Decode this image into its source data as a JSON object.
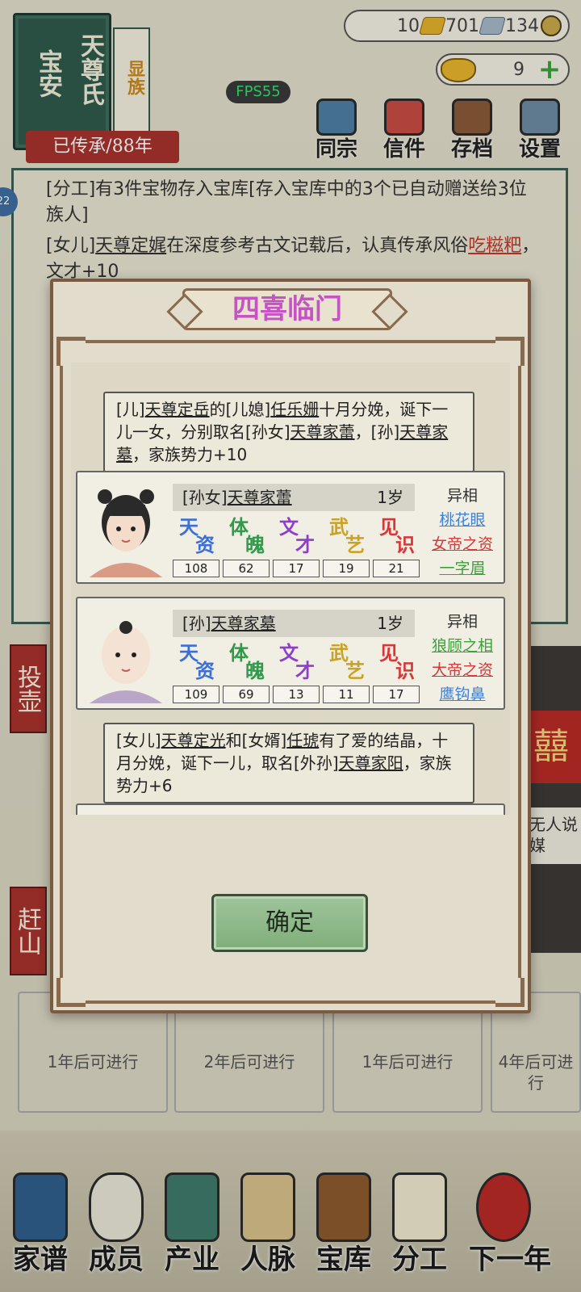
{
  "banner": {
    "title_col1": "天尊氏",
    "title_col2": "宝安",
    "tag": "显族",
    "generation": "已传承/88年"
  },
  "fps": "FPS55",
  "resources": {
    "gold_bar": "10",
    "silver_bar": "701",
    "coin": "134",
    "ingot": "9"
  },
  "top_menu": [
    "同宗",
    "信件",
    "存档",
    "设置"
  ],
  "log": {
    "badge": "22",
    "line1": "[分工]有3件宝物存入宝库[存入宝库中的3个已自动赠送给3位族人]",
    "line2_prefix": "[女儿]",
    "line2_name": "天尊定娓",
    "line2_mid": "在深度参考古文记载后，认真传承风俗",
    "line2_custom": "吃糍粑",
    "line2_suffix": "，文才+10"
  },
  "side_tabs": [
    "投壶",
    "赶山"
  ],
  "bg_cards": [
    "1年后可进行",
    "2年后可进行",
    "1年后可进行",
    "4年后可进行"
  ],
  "right_card": {
    "xi": "囍",
    "msg": "无人说媒"
  },
  "bottom_nav": [
    "家谱",
    "成员",
    "产业",
    "人脉",
    "宝库",
    "分工",
    "下一年"
  ],
  "dialog": {
    "title": "四喜临门",
    "event1": {
      "p1": "[儿]",
      "n1": "天尊定岳",
      "p2": "的[儿媳]",
      "n2": "任乐姗",
      "p3": "十月分娩，诞下一儿一女，分别取名[孙女]",
      "n3": "天尊家蕾",
      "p4": "，[孙]",
      "n4": "天尊家墓",
      "p5": "，家族势力+10"
    },
    "chars": [
      {
        "relation": "[孙女]",
        "name": "天尊家蕾",
        "age": "1岁",
        "stats": [
          {
            "l1": "天",
            "l2": "资",
            "value": "108",
            "color": "#3b6fd6"
          },
          {
            "l1": "体",
            "l2": "魄",
            "value": "62",
            "color": "#2e9b4a"
          },
          {
            "l1": "文",
            "l2": "才",
            "value": "17",
            "color": "#8e3fc9"
          },
          {
            "l1": "武",
            "l2": "艺",
            "value": "19",
            "color": "#c9a224"
          },
          {
            "l1": "见",
            "l2": "识",
            "value": "21",
            "color": "#d23a3a"
          }
        ],
        "traits_head": "异相",
        "traits": [
          {
            "name": "桃花眼",
            "color": "#3e82d6"
          },
          {
            "name": "女帝之资",
            "color": "#d23a3a"
          },
          {
            "name": "一字眉",
            "color": "#3aa33a"
          }
        ]
      },
      {
        "relation": "[孙]",
        "name": "天尊家墓",
        "age": "1岁",
        "stats": [
          {
            "l1": "天",
            "l2": "资",
            "value": "109",
            "color": "#3b6fd6"
          },
          {
            "l1": "体",
            "l2": "魄",
            "value": "69",
            "color": "#2e9b4a"
          },
          {
            "l1": "文",
            "l2": "才",
            "value": "13",
            "color": "#8e3fc9"
          },
          {
            "l1": "武",
            "l2": "艺",
            "value": "11",
            "color": "#c9a224"
          },
          {
            "l1": "见",
            "l2": "识",
            "value": "17",
            "color": "#d23a3a"
          }
        ],
        "traits_head": "异相",
        "traits": [
          {
            "name": "狼顾之相",
            "color": "#3aa33a"
          },
          {
            "name": "大帝之资",
            "color": "#d23a3a"
          },
          {
            "name": "鹰钩鼻",
            "color": "#3e82d6"
          }
        ]
      }
    ],
    "event2": {
      "p1": "[女儿]",
      "n1": "天尊定光",
      "p2": "和[女婿]",
      "n2": "任琥",
      "p3": "有了爱的结晶，十月分娩，诞下一儿，取名[外孙]",
      "n3": "天尊家阳",
      "p4": "，家族势力+6"
    },
    "confirm": "确定"
  }
}
